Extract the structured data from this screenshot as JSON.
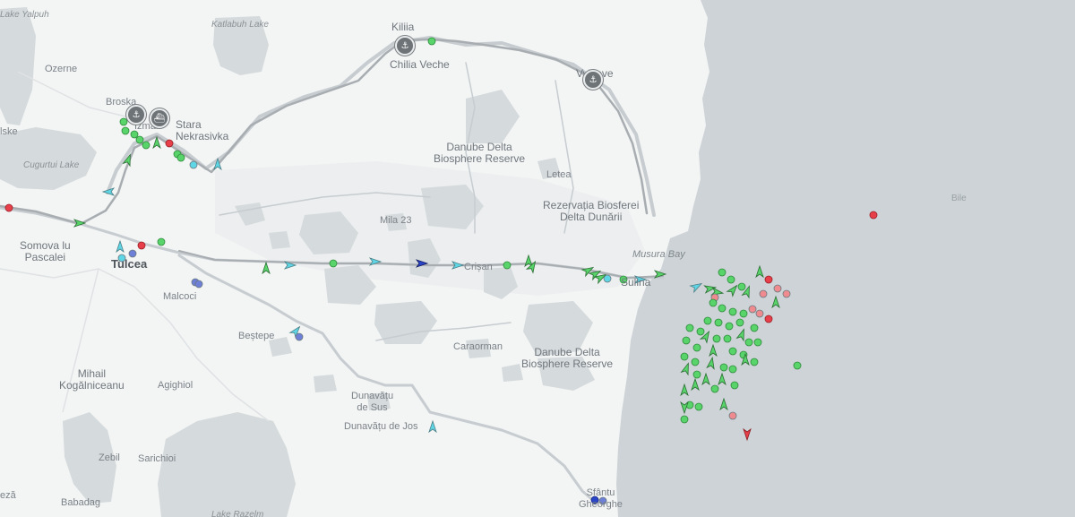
{
  "map": {
    "colors": {
      "land": "#f3f4f4",
      "sea": "#cdd3d6",
      "lake": "#d5dadc",
      "river": "#c6ccd0",
      "route": "#a8adb1",
      "vessel_green": "#58d46a",
      "vessel_cyan": "#5fd6e6",
      "vessel_red": "#e8404a",
      "vessel_pink": "#ef8b8f",
      "vessel_blue": "#2b45c9",
      "vessel_periwinkle": "#6d7fd6"
    },
    "labels": {
      "lake_yalpuh": "Lake Yalpuh",
      "katlabuh_lake": "Katlabuh Lake",
      "ozerne": "Ozerne",
      "broska": "Broska",
      "izmail": "Izmail",
      "iske": "lske",
      "cugurtui_lake": "Cugurtui Lake",
      "stara_nekrasivka": "Stara\nNekrasivka",
      "kiliia": "Kiliia",
      "chilia_veche": "Chilia Veche",
      "vylkove": "Vylkove",
      "danube_delta_1": "Danube Delta\nBiosphere Reserve",
      "letea": "Letea",
      "rezervatia": "Rezervația Biosferei\nDelta Dunării",
      "mila_23": "Mila 23",
      "musura_bay": "Musura Bay",
      "sulina": "Sulina",
      "crisan": "Crișan",
      "somova": "Somova lu\nPascalei",
      "tulcea": "Tulcea",
      "malcoci": "Malcoci",
      "bestepe": "Beștepe",
      "caraorman": "Caraorman",
      "danube_delta_2": "Danube Delta\nBiosphere Reserve",
      "mihail": "Mihail\nKogălniceanu",
      "agighiol": "Agighiol",
      "dunavatu_sus": "Dunavățu\nde Sus",
      "dunavatu_jos": "Dunavățu de Jos",
      "zebil": "Zebil",
      "sarichioi": "Sarichioi",
      "babadag": "Babadag",
      "lake_razelm": "Lake Razelm",
      "sfantu_gheorghe": "Sfântu\nGheorghe",
      "bile": "Bile",
      "edge_label": "eză"
    },
    "ports": [
      {
        "name": "port-kiliia",
        "icon": "anchor-icon"
      },
      {
        "name": "port-vylkove",
        "icon": "anchor-icon"
      },
      {
        "name": "port-broska",
        "icon": "anchor-icon"
      },
      {
        "name": "port-izmail",
        "icon": "ship-icon"
      }
    ]
  }
}
